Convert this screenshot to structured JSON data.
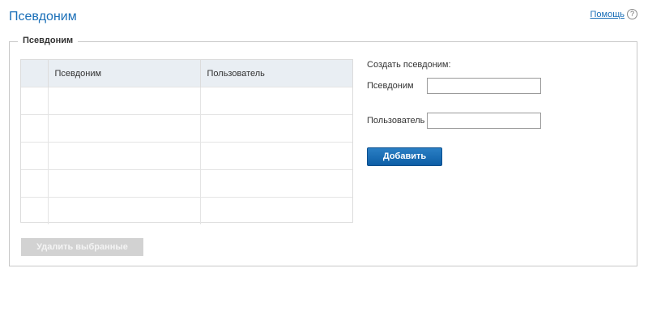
{
  "header": {
    "title": "Псевдоним",
    "help_label": "Помощь",
    "help_icon": "?"
  },
  "section": {
    "legend": "Псевдоним"
  },
  "table": {
    "columns": [
      "",
      "Псевдоним",
      "Пользователь"
    ],
    "rows": [
      [
        "",
        "",
        ""
      ],
      [
        "",
        "",
        ""
      ],
      [
        "",
        "",
        ""
      ],
      [
        "",
        "",
        ""
      ],
      [
        "",
        "",
        ""
      ]
    ]
  },
  "create": {
    "title": "Создать псевдоним:",
    "alias_label": "Псевдоним",
    "alias_value": "",
    "user_label": "Пользователь",
    "user_value": "",
    "add_label": "Добавить"
  },
  "actions": {
    "delete_selected_label": "Удалить выбранные"
  },
  "colors": {
    "accent": "#1a6fb8",
    "button": "#0d5ea6",
    "disabled": "#d2d2d2",
    "header_bg": "#e9eef3"
  }
}
